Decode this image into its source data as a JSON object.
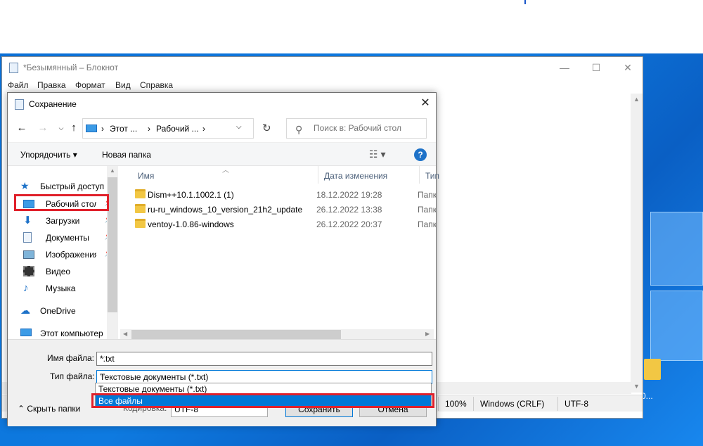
{
  "notepad": {
    "title": "*Безымянный – Блокнот",
    "controls": {
      "minimize": "—",
      "maximize": "☐",
      "close": "✕"
    },
    "menu": [
      "Файл",
      "Правка",
      "Формат",
      "Вид",
      "Справка"
    ],
    "status": {
      "zoom": "100%",
      "line_ending": "Windows (CRLF)",
      "encoding": "UTF-8"
    }
  },
  "dialog": {
    "title": "Сохранение",
    "close": "✕",
    "address": {
      "crumb1": "Этот ...",
      "crumb2": "Рабочий ...",
      "sep": "›"
    },
    "search_placeholder": "Поиск в: Рабочий стол",
    "toolbar": {
      "organize": "Упорядочить ▾",
      "new_folder": "Новая папка",
      "view": "☷  ▾",
      "help": "?"
    },
    "nav": {
      "quick_access": "Быстрый доступ",
      "items": [
        {
          "label": "Рабочий стол"
        },
        {
          "label": "Загрузки"
        },
        {
          "label": "Документы"
        },
        {
          "label": "Изображения"
        },
        {
          "label": "Видео"
        },
        {
          "label": "Музыка"
        }
      ],
      "onedrive": "OneDrive",
      "this_pc": "Этот компьютер"
    },
    "columns": {
      "name": "Имя",
      "date": "Дата изменения",
      "type": "Тип"
    },
    "files": [
      {
        "name": "Dism++10.1.1002.1 (1)",
        "date": "18.12.2022 19:28",
        "type": "Папк"
      },
      {
        "name": "ru-ru_windows_10_version_21h2_update...",
        "date": "26.12.2022 13:38",
        "type": "Папк"
      },
      {
        "name": "ventoy-1.0.86-windows",
        "date": "26.12.2022 20:37",
        "type": "Папк"
      }
    ],
    "form": {
      "filename_label": "Имя файла:",
      "filename_value": "*.txt",
      "filetype_label": "Тип файла:",
      "filetype_value": "Текстовые документы (*.txt)",
      "encoding_label": "Кодировка:",
      "encoding_value": "UTF-8",
      "hide_folders": "Скрыть папки",
      "save": "Сохранить",
      "cancel": "Отмена"
    },
    "dropdown_options": [
      "Текстовые документы (*.txt)",
      "Все файлы"
    ]
  },
  "desktop": {
    "folder_caption": "0..."
  },
  "colors": {
    "accent": "#0078d7",
    "highlight": "#e0202a",
    "folder": "#f2c744",
    "desktop": "#0a6fd6"
  }
}
